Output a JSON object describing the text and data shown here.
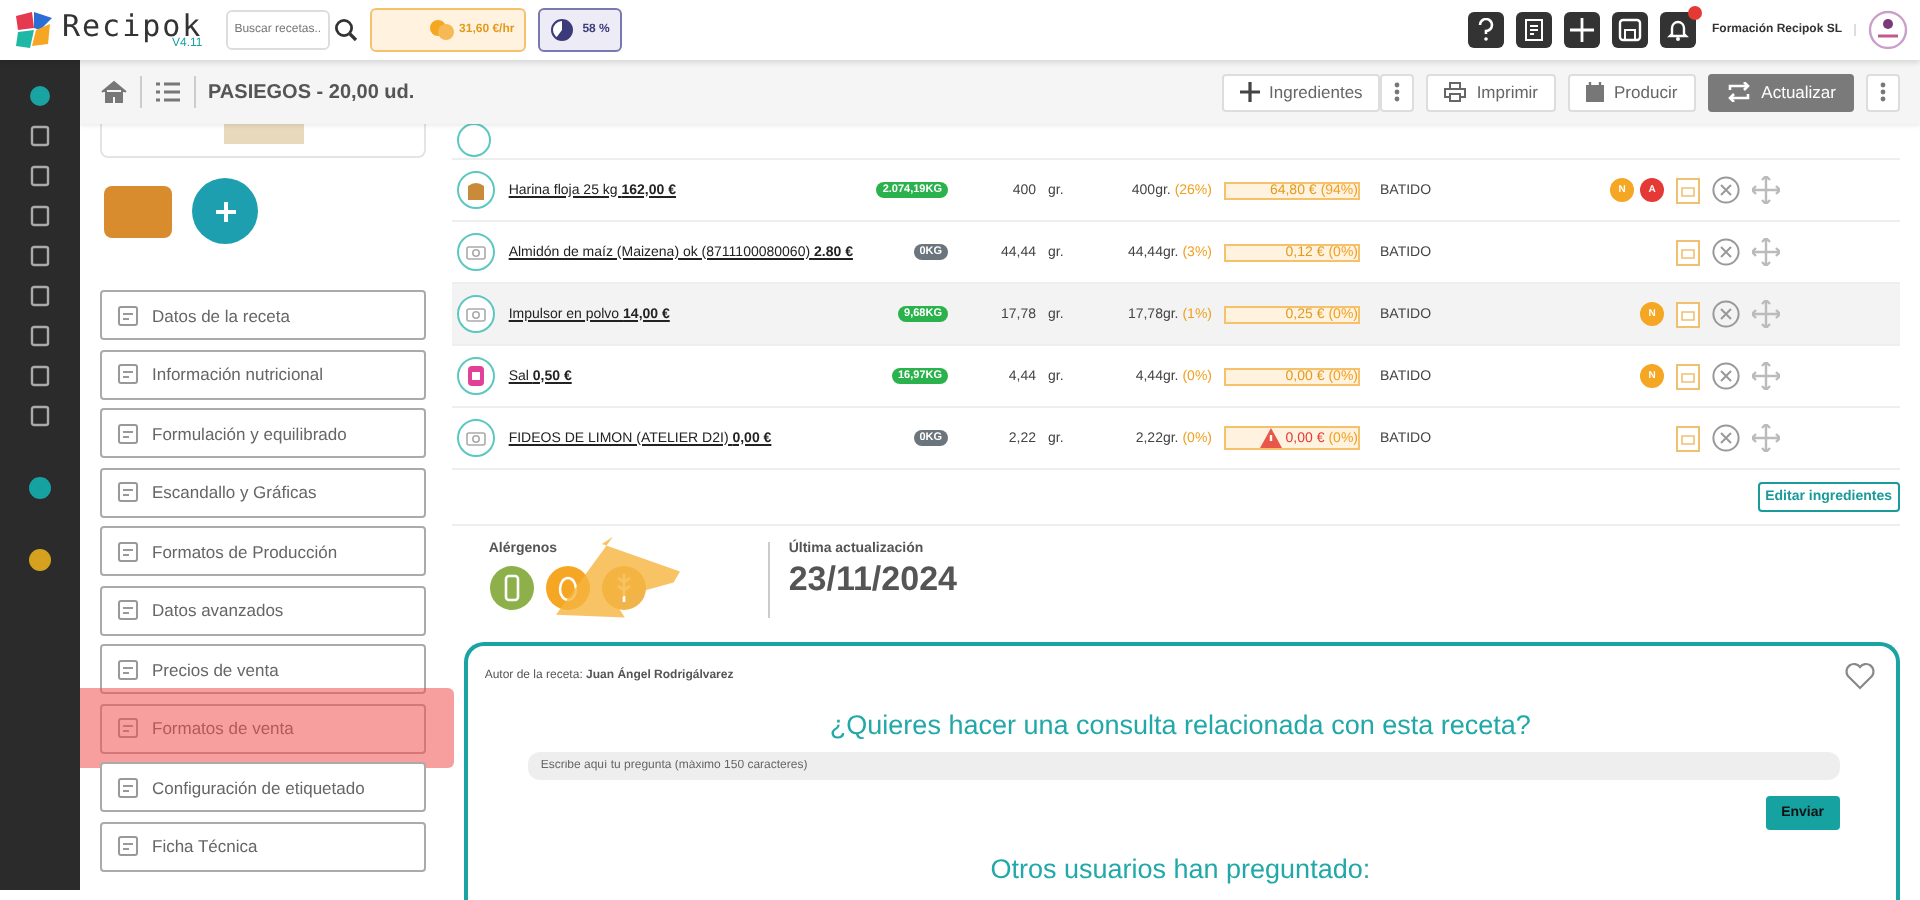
{
  "header": {
    "logo": "Recipok",
    "version": "V4.11",
    "search": {
      "placeholder": "Buscar recetas..."
    },
    "cost_chip": "31,60 €/hr",
    "percent_chip": "58 %",
    "company": "Formación Recipok SL"
  },
  "toolbar": {
    "title": "PASIEGOS - 20,00 ud.",
    "buttons": [
      {
        "label": "Ingredientes",
        "kind": "add",
        "primary": false
      },
      {
        "label": "Imprimir",
        "kind": "print",
        "primary": false
      },
      {
        "label": "Producir",
        "kind": "produce",
        "primary": false
      },
      {
        "label": "Actualizar",
        "kind": "refresh",
        "primary": true
      }
    ]
  },
  "menu": [
    {
      "label": "Datos de la receta",
      "highlighted": false
    },
    {
      "label": "Información nutricional",
      "highlighted": false
    },
    {
      "label": "Formulación y equilibrado",
      "highlighted": false
    },
    {
      "label": "Escandallo y Gráficas",
      "highlighted": false
    },
    {
      "label": "Formatos de Producción",
      "highlighted": false
    },
    {
      "label": "Datos avanzados",
      "highlighted": false
    },
    {
      "label": "Precios de venta",
      "highlighted": false
    },
    {
      "label": "Formatos de venta",
      "highlighted": true
    },
    {
      "label": "Configuración de etiquetado",
      "highlighted": false
    },
    {
      "label": "Ficha Técnica",
      "highlighted": false
    }
  ],
  "ingredients": [
    {
      "name": "Harina floja 25 kg **162,00 €**",
      "kind": "sack",
      "stock": "2.074,19KG",
      "color": "#2bb24c",
      "qty": "400",
      "unit": "gr.",
      "weight": "400gr.",
      "weight_pct": "(26%)",
      "warning": false,
      "cost": "64,80 €",
      "cost_pct": "(94%)",
      "phase": "BATIDO",
      "tags": [
        {
          "label": "N",
          "color": "#f5a623"
        },
        {
          "label": "A",
          "color": "#e53935"
        }
      ],
      "highlighted": false
    },
    {
      "name": "Almidón de maíz (Maizena) ok (8711100080060) **2.80 €**",
      "kind": "photo",
      "stock": "0KG",
      "color": "#6c757d",
      "qty": "44,44",
      "unit": "gr.",
      "weight": "44,44gr.",
      "weight_pct": "(3%)",
      "warning": false,
      "cost": "0,12 €",
      "cost_pct": "(0%)",
      "phase": "BATIDO",
      "highlighted": false
    },
    {
      "name": "Impulsor en polvo **14,00 €**",
      "kind": "photo",
      "stock": "9,68KG",
      "color": "#2bb24c",
      "qty": "17,78",
      "unit": "gr.",
      "weight": "17,78gr.",
      "weight_pct": "(1%)",
      "warning": false,
      "cost": "0,25 €",
      "cost_pct": "(0%)",
      "phase": "BATIDO",
      "tags": [
        {
          "label": "N",
          "color": "#f5a623"
        }
      ],
      "highlighted": true
    },
    {
      "name": "Sal **0,50 €**",
      "kind": "jar",
      "stock": "16,97KG",
      "color": "#2bb24c",
      "qty": "4,44",
      "unit": "gr.",
      "weight": "4,44gr.",
      "weight_pct": "(0%)",
      "warning": false,
      "cost": "0,00 €",
      "cost_pct": "(0%)",
      "phase": "BATIDO",
      "tags": [
        {
          "label": "N",
          "color": "#f5a623"
        }
      ],
      "highlighted": false
    },
    {
      "name": "FIDEOS DE LIMON (ATELIER D2I) **0,00 €**",
      "kind": "photo",
      "stock": "0KG",
      "color": "#6c757d",
      "qty": "2,22",
      "unit": "gr.",
      "weight": "2,22gr.",
      "weight_pct": "(0%)",
      "warning": true,
      "cost": "0,00 €",
      "cost_pct": "(0%)",
      "phase": "BATIDO",
      "highlighted": false
    }
  ],
  "edit_button": "Editar ingredientes",
  "allergens": {
    "label": "Alérgenos",
    "items": [
      {
        "kind": "milk",
        "color": "#8db04a"
      },
      {
        "kind": "egg",
        "color": "#f5a623"
      },
      {
        "kind": "gluten",
        "color": "#f0b44a"
      }
    ]
  },
  "last_update": {
    "label": "Última actualización",
    "date": "23/11/2024"
  },
  "questions": {
    "author": "Autor de la receta: **Juan Ángel Rodrigálvarez**",
    "heading": "¿Quieres hacer una consulta relacionada con esta receta?",
    "input": {
      "placeholder": "Escribe aquí tu pregunta (máximo 150 caracteres)"
    },
    "send": "Enviar",
    "others": "Otros usuarios han preguntado:"
  }
}
